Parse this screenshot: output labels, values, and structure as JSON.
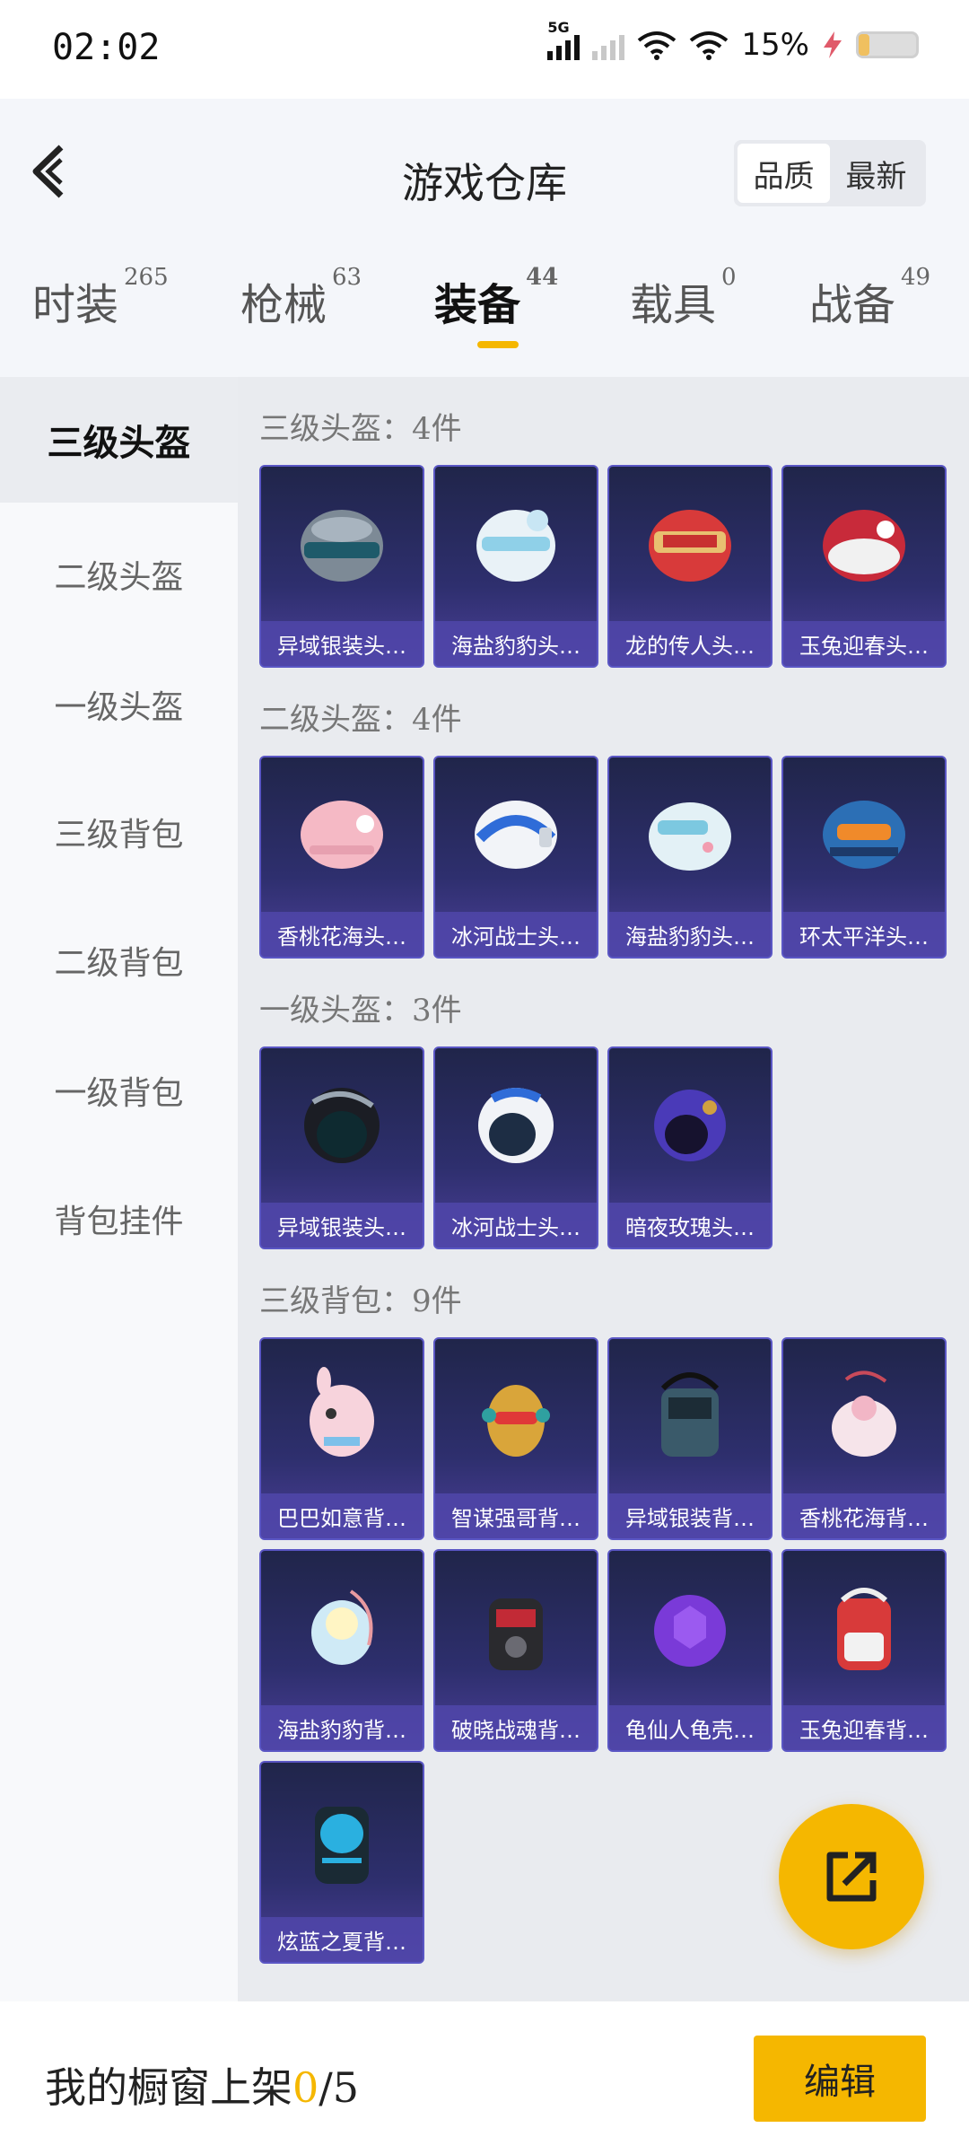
{
  "status": {
    "time": "02:02",
    "network": "5G",
    "battery": "15%"
  },
  "header": {
    "title": "游戏仓库",
    "sort": [
      "品质",
      "最新"
    ]
  },
  "tabs": [
    {
      "label": "时装",
      "count": "265"
    },
    {
      "label": "枪械",
      "count": "63"
    },
    {
      "label": "装备",
      "count": "44"
    },
    {
      "label": "载具",
      "count": "0"
    },
    {
      "label": "战备",
      "count": "49"
    }
  ],
  "sidebar": [
    "三级头盔",
    "二级头盔",
    "一级头盔",
    "三级背包",
    "二级背包",
    "一级背包",
    "背包挂件"
  ],
  "sections": [
    {
      "title": "三级头盔：4件",
      "items": [
        "异域银装头…",
        "海盐豹豹头…",
        "龙的传人头…",
        "玉兔迎春头…"
      ]
    },
    {
      "title": "二级头盔：4件",
      "items": [
        "香桃花海头…",
        "冰河战士头…",
        "海盐豹豹头…",
        "环太平洋头…"
      ]
    },
    {
      "title": "一级头盔：3件",
      "items": [
        "异域银装头…",
        "冰河战士头…",
        "暗夜玫瑰头…"
      ]
    },
    {
      "title": "三级背包：9件",
      "items": [
        "巴巴如意背…",
        "智谋强哥背…",
        "异域银装背…",
        "香桃花海背…",
        "海盐豹豹背…",
        "破晓战魂背…",
        "龟仙人龟壳…",
        "玉兔迎春背…",
        "炫蓝之夏背…"
      ]
    }
  ],
  "bottom": {
    "prefix": "我的橱窗上架",
    "current": "0",
    "total": "/5",
    "edit_label": "编辑"
  }
}
